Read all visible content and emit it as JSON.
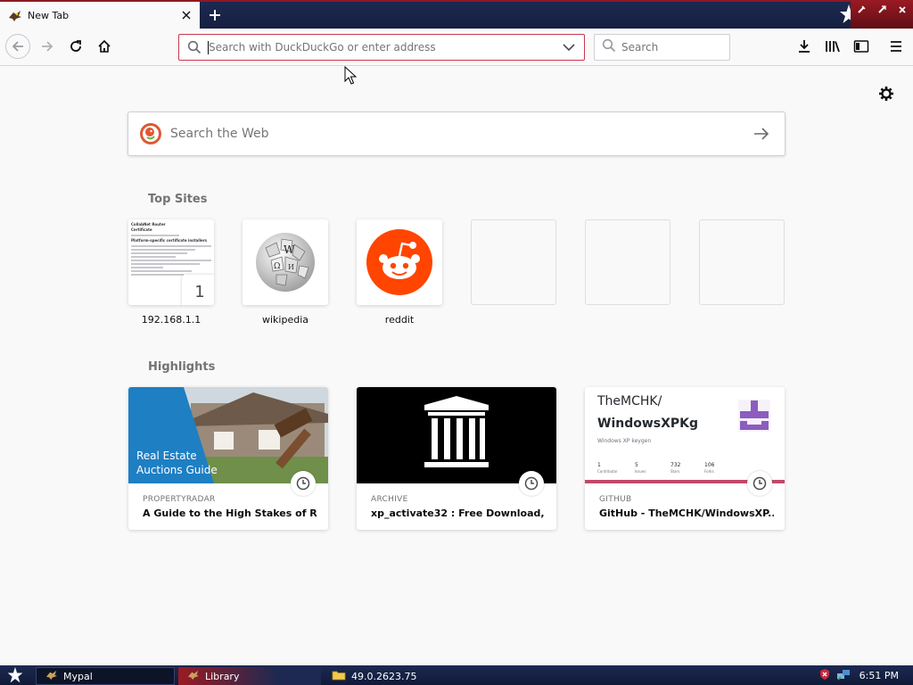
{
  "tab": {
    "title": "New Tab"
  },
  "urlbar": {
    "placeholder": "Search with DuckDuckGo or enter address"
  },
  "searchbar": {
    "placeholder": "Search"
  },
  "content": {
    "websearch_placeholder": "Search the Web",
    "top_sites_title": "Top Sites",
    "highlights_title": "Highlights",
    "top_sites": [
      {
        "label": "192.168.1.1",
        "badge": "1",
        "shot_lines": [
          "CollabNet Router",
          "Certificate",
          "Platform-specific certificate installers"
        ]
      },
      {
        "label": "wikipedia"
      },
      {
        "label": "reddit"
      }
    ],
    "highlights": [
      {
        "source": "PROPERTYRADAR",
        "title": "A Guide to the High Stakes of R...",
        "thumb_text": [
          "Real Estate",
          "Auctions Guide"
        ]
      },
      {
        "source": "ARCHIVE",
        "title": "xp_activate32 : Free Download, ..."
      },
      {
        "source": "GITHUB",
        "title": "GitHub - TheMCHK/WindowsXP...",
        "thumb_text": [
          "TheMCHK/",
          "WindowsXPKg",
          "Windows XP keygen"
        ],
        "stats": [
          "1",
          "5",
          "732",
          "106"
        ],
        "stat_labels": [
          "Contributor",
          "Issues",
          "Stars",
          "Forks"
        ]
      }
    ]
  },
  "taskbar": {
    "items": [
      {
        "label": "Mypal"
      },
      {
        "label": "Library"
      },
      {
        "label": "49.0.2623.75"
      }
    ],
    "time": "6:51 PM"
  },
  "colors": {
    "accent_red": "#c6394b",
    "taskbar_navy": "#1d2952",
    "reddit_orange": "#ff4500",
    "ddg_orange": "#de5833",
    "github_purple": "#8c5cbf"
  }
}
